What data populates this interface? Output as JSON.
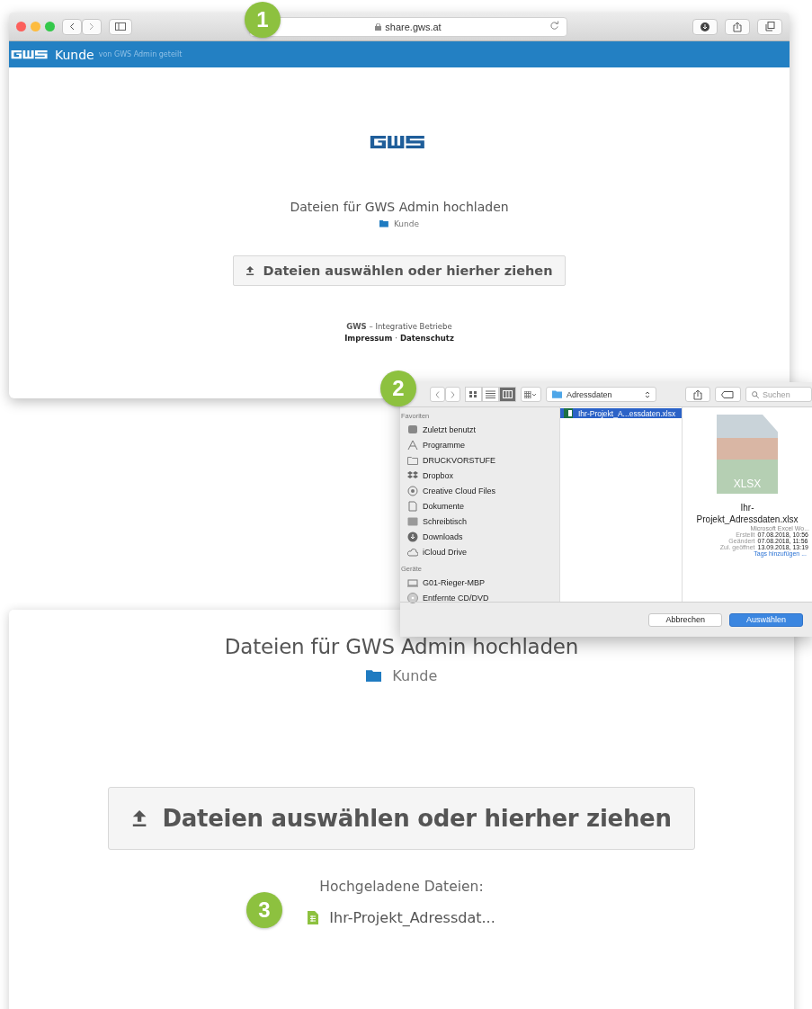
{
  "browser": {
    "badge": "1",
    "address": "share.gws.at",
    "header": {
      "title": "Kunde",
      "subtitle": "von GWS Admin geteilt"
    },
    "heading": "Dateien für GWS Admin hochladen",
    "folder": "Kunde",
    "upload_button": "Dateien auswählen oder hierher ziehen",
    "footer": {
      "line": "**GWS** – Integrative Betriebe",
      "links": [
        "Impressum",
        "Datenschutz"
      ],
      "separator": "·"
    }
  },
  "dialog": {
    "badge": "2",
    "views": [
      {
        "selected": false
      },
      {
        "selected": false
      },
      {
        "selected": true
      }
    ],
    "path": "Adressdaten",
    "search": {
      "placeholder": "Suchen"
    },
    "sections": [
      {
        "title": "Favoriten",
        "items": [
          {
            "label": "Zuletzt benutzt",
            "selected": false
          },
          {
            "label": "Programme",
            "selected": false
          },
          {
            "label": "DRUCKVORSTUFE",
            "selected": false
          },
          {
            "label": "Dropbox",
            "selected": false
          },
          {
            "label": "Creative Cloud Files",
            "selected": false
          },
          {
            "label": "Dokumente",
            "selected": false
          },
          {
            "label": "Schreibtisch",
            "selected": false
          },
          {
            "label": "Downloads",
            "selected": false
          },
          {
            "label": "iCloud Drive",
            "selected": false
          }
        ]
      },
      {
        "title": "Geräte",
        "items": [
          {
            "label": "G01-Rieger-MBP",
            "selected": false
          },
          {
            "label": "Entfernte CD/DVD",
            "selected": false
          }
        ]
      }
    ],
    "files": [
      {
        "name": "Ihr-Projekt_A...essdaten.xlsx",
        "selected": true
      }
    ],
    "preview": {
      "thumb_label": "XLSX",
      "name_lines": [
        "Ihr-",
        "Projekt_Adressdaten.xlsx"
      ],
      "kind": "Microsoft Excel Wo...",
      "info": [
        {
          "label": "Erstellt",
          "value": "07.08.2018, 10:56"
        },
        {
          "label": "Geändert",
          "value": "07.08.2018, 11:56"
        },
        {
          "label": "Zul. geöffnet",
          "value": "13.09.2018, 13:19"
        }
      ],
      "tags_link": "Tags hinzufügen ..."
    },
    "buttons": [
      {
        "label": "Abbrechen",
        "kind": "default"
      },
      {
        "label": "Auswählen",
        "kind": "primary"
      }
    ]
  },
  "result": {
    "badge": "3",
    "heading": "Dateien für GWS Admin hochladen",
    "folder": "Kunde",
    "upload_button": "Dateien auswählen oder hierher ziehen",
    "uploaded_title": "Hochgeladene Dateien:",
    "uploaded_files": [
      "Ihr-Projekt_Adressdat..."
    ]
  }
}
